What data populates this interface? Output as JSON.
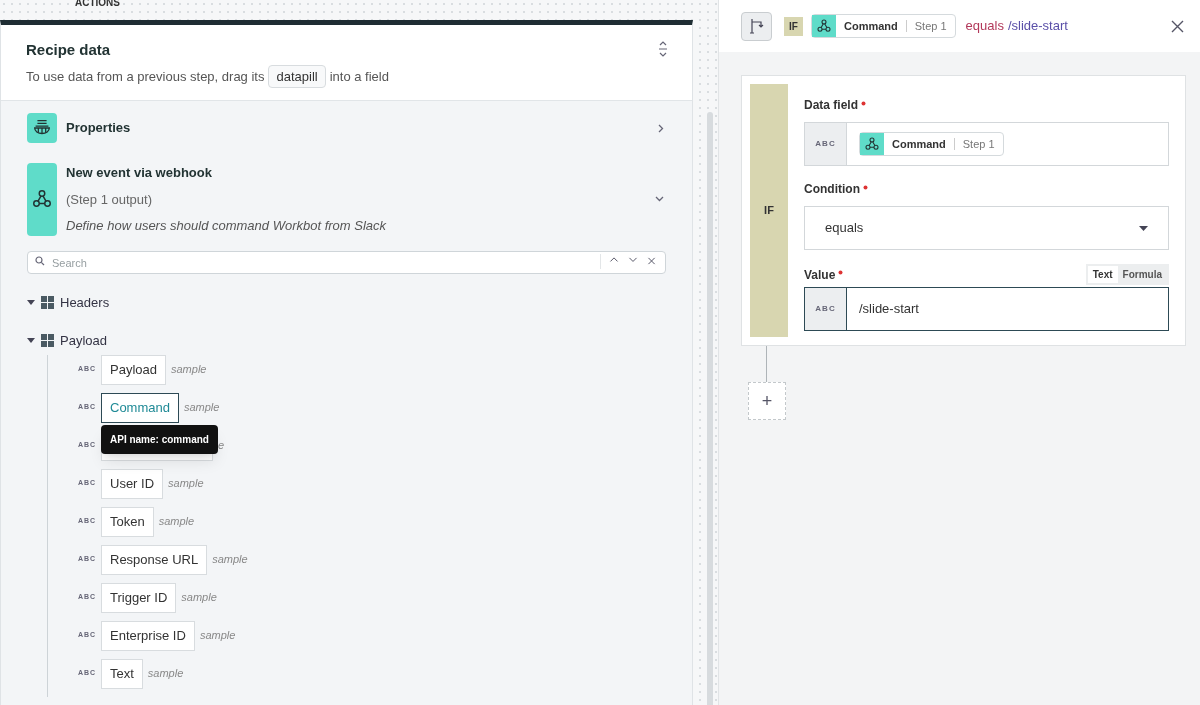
{
  "canvas_label": "ACTIONS",
  "recipe_panel": {
    "title": "Recipe data",
    "hint_before": "To use data from a previous step, drag its",
    "hint_pill": "datapill",
    "hint_after": "into a field"
  },
  "sections": [
    {
      "kind": "properties",
      "title": "Properties",
      "expanded": false
    },
    {
      "kind": "trigger",
      "title": "New event via webhook",
      "subtitle": "(Step 1 output)",
      "description": "Define how users should command Workbot from Slack",
      "expanded": true
    }
  ],
  "search": {
    "placeholder": "Search"
  },
  "tree": [
    {
      "label": "Headers",
      "expanded": true
    },
    {
      "label": "Payload",
      "expanded": true,
      "children": [
        {
          "type": "ABC",
          "label": "Payload",
          "hint": "sample",
          "hovered": false
        },
        {
          "type": "ABC",
          "label": "Command",
          "hint": "sample",
          "hovered": true
        },
        {
          "type": "ABC",
          "hint": "e",
          "hovered": false
        },
        {
          "type": "ABC",
          "label": "User ID",
          "hint": "sample",
          "hovered": false
        },
        {
          "type": "ABC",
          "label": "Token",
          "hint": "sample",
          "hovered": false
        },
        {
          "type": "ABC",
          "label": "Response URL",
          "hint": "sample",
          "hovered": false
        },
        {
          "type": "ABC",
          "label": "Trigger ID",
          "hint": "sample",
          "hovered": false
        },
        {
          "type": "ABC",
          "label": "Enterprise ID",
          "hint": "sample",
          "hovered": false
        },
        {
          "type": "ABC",
          "label": "Text",
          "hint": "sample",
          "hovered": false
        }
      ]
    }
  ],
  "tooltip": {
    "text": "API name: command"
  },
  "step_header": {
    "badge": "IF",
    "pill": {
      "label": "Command",
      "step": "Step 1"
    },
    "operator": "equals",
    "value": "/slide-start"
  },
  "step_form": {
    "block_label": "IF",
    "fields": [
      {
        "kind": "pill",
        "label": "Data field",
        "required": true,
        "type": "ABC",
        "pill": {
          "label": "Command",
          "step": "Step 1"
        }
      },
      {
        "kind": "select",
        "label": "Condition",
        "required": true,
        "value": "equals"
      },
      {
        "kind": "text",
        "label": "Value",
        "required": true,
        "type": "ABC",
        "value": "/slide-start",
        "modes": [
          {
            "label": "Text",
            "selected": true
          },
          {
            "label": "Formula",
            "selected": false
          }
        ]
      }
    ]
  },
  "add_step": {
    "label": "+"
  }
}
